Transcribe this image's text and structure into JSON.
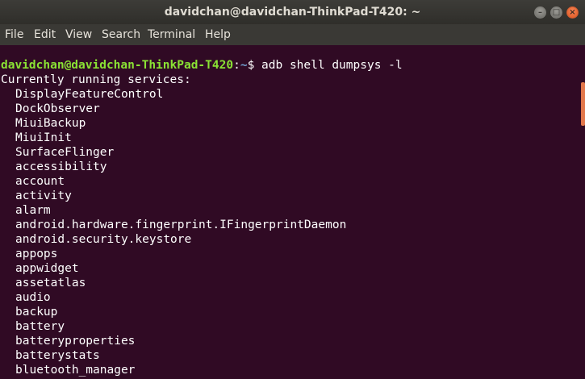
{
  "window": {
    "title": "davidchan@davidchan-ThinkPad-T420: ~",
    "controls": {
      "minimize": "–",
      "maximize": "□",
      "close": "×"
    }
  },
  "menu": [
    "File",
    "Edit",
    "View",
    "Search",
    "Terminal",
    "Help"
  ],
  "terminal": {
    "prompt_user": "davidchan@davidchan-ThinkPad-T420",
    "prompt_sep": ":",
    "prompt_path": "~",
    "prompt_symbol": "$ ",
    "command": "adb shell dumpsys -l",
    "output_header": "Currently running services:",
    "services": [
      "DisplayFeatureControl",
      "DockObserver",
      "MiuiBackup",
      "MiuiInit",
      "SurfaceFlinger",
      "accessibility",
      "account",
      "activity",
      "alarm",
      "android.hardware.fingerprint.IFingerprintDaemon",
      "android.security.keystore",
      "appops",
      "appwidget",
      "assetatlas",
      "audio",
      "backup",
      "battery",
      "batteryproperties",
      "batterystats",
      "bluetooth_manager"
    ]
  },
  "colors": {
    "terminal_bg": "#300a24",
    "prompt_user": "#8ae234",
    "prompt_path": "#729fcf",
    "scrollbar": "#e2774b"
  }
}
